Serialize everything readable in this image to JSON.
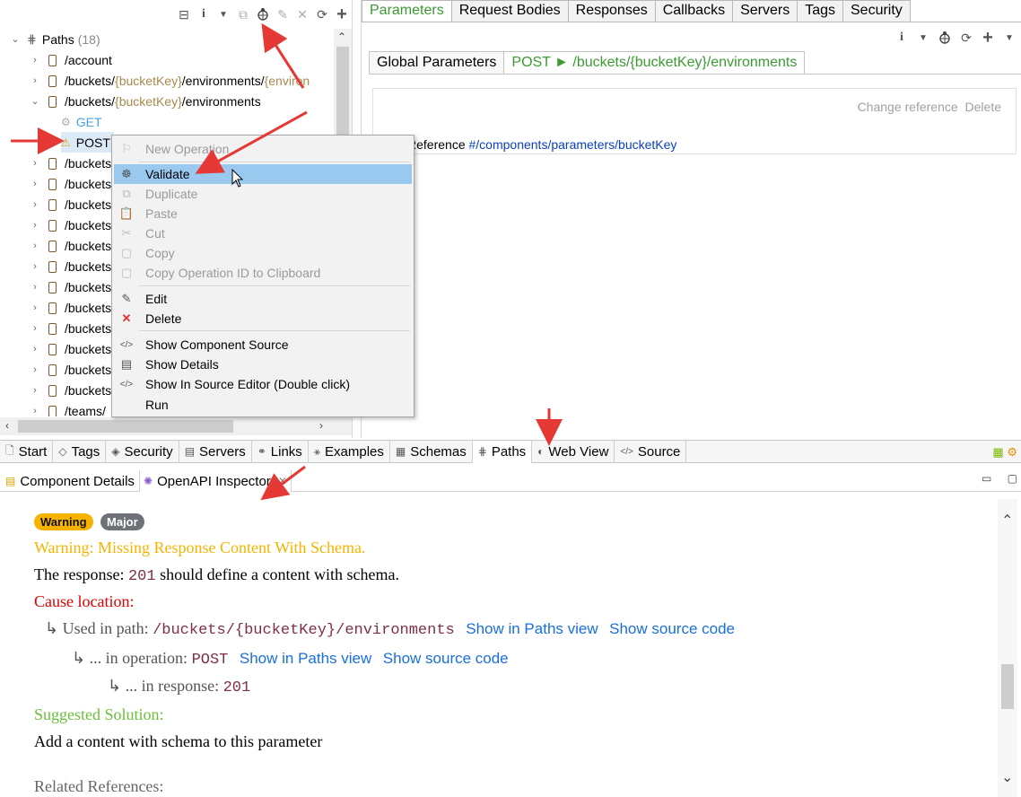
{
  "left_toolbar": {
    "icons": [
      "collapse-icon",
      "info-icon",
      "dropdown-icon",
      "copy-icon",
      "validate-icon",
      "edit-icon",
      "close-icon",
      "refresh-icon",
      "add-icon"
    ]
  },
  "tree": {
    "root_label": "Paths",
    "root_count": "(18)",
    "rows": [
      {
        "prefix": "/account",
        "param": "",
        "suffix": ""
      },
      {
        "prefix": "/buckets/",
        "param": "{bucketKey}",
        "suffix": "/environments/",
        "param2": "{environ"
      },
      {
        "prefix": "/buckets/",
        "param": "{bucketKey}",
        "suffix": "/environments"
      },
      {
        "prefix": "/buckets",
        "param": "",
        "suffix": ""
      },
      {
        "prefix": "/buckets",
        "param": "",
        "suffix": ""
      },
      {
        "prefix": "/buckets",
        "param": "",
        "suffix": ""
      },
      {
        "prefix": "/buckets",
        "param": "",
        "suffix": ""
      },
      {
        "prefix": "/buckets",
        "param": "",
        "suffix": ""
      },
      {
        "prefix": "/buckets",
        "param": "",
        "suffix": ""
      },
      {
        "prefix": "/buckets",
        "param": "",
        "suffix": ""
      },
      {
        "prefix": "/buckets",
        "param": "",
        "suffix": ""
      },
      {
        "prefix": "/buckets",
        "param": "",
        "suffix": ""
      },
      {
        "prefix": "/buckets",
        "param": "",
        "suffix": ""
      },
      {
        "prefix": "/buckets",
        "param": "",
        "suffix": ""
      },
      {
        "prefix": "/buckets",
        "param": "",
        "suffix": ""
      },
      {
        "prefix": "/teams/",
        "param": "",
        "suffix": ""
      }
    ],
    "get_label": "GET",
    "post_label": "POST"
  },
  "top_tabs": [
    "Parameters",
    "Request Bodies",
    "Responses",
    "Callbacks",
    "Servers",
    "Tags",
    "Security"
  ],
  "sub_tabs": {
    "global": "Global Parameters",
    "active": "POST ► /buckets/{bucketKey}/environments"
  },
  "param_box": {
    "change_reference": "Change reference",
    "delete": "Delete",
    "label": "eter Reference",
    "reference": "#/components/parameters/bucketKey"
  },
  "context_menu": {
    "items": [
      {
        "label": "New Operation",
        "icon": "new-icon",
        "disabled": true
      },
      {
        "label": "Validate",
        "icon": "validate-icon",
        "disabled": false,
        "highlight": true
      },
      {
        "label": "Duplicate",
        "icon": "duplicate-icon",
        "disabled": true
      },
      {
        "label": "Paste",
        "icon": "paste-icon",
        "disabled": true
      },
      {
        "label": "Cut",
        "icon": "cut-icon",
        "disabled": true
      },
      {
        "label": "Copy",
        "icon": "copy-icon",
        "disabled": true
      },
      {
        "label": "Copy Operation ID to Clipboard",
        "icon": "clipboard-icon",
        "disabled": true
      },
      {
        "label": "Edit",
        "icon": "edit-icon",
        "disabled": false
      },
      {
        "label": "Delete",
        "icon": "delete-icon",
        "disabled": false
      },
      {
        "label": "Show Component Source",
        "icon": "code-icon",
        "disabled": false
      },
      {
        "label": "Show Details",
        "icon": "details-icon",
        "disabled": false
      },
      {
        "label": "Show In Source Editor (Double click)",
        "icon": "code-icon",
        "disabled": false
      },
      {
        "label": "Run",
        "icon": "",
        "disabled": false
      }
    ]
  },
  "editor_tabs": [
    "Start",
    "Tags",
    "Security",
    "Servers",
    "Links",
    "Examples",
    "Schemas",
    "Paths",
    "Web View",
    "Source"
  ],
  "editor_tabs_active": "Paths",
  "views": {
    "component_details": "Component Details",
    "openapi_inspector": "OpenAPI Inspector"
  },
  "inspector": {
    "badge_warning": "Warning",
    "badge_major": "Major",
    "title": "Warning: Missing Response Content With Schema.",
    "response_prefix": "The response:",
    "response_code": "201",
    "response_suffix": "should define a content with schema.",
    "cause_location": "Cause location:",
    "used_in_path_label": "↳ Used in path:",
    "used_in_path_value": "/buckets/{bucketKey}/environments",
    "show_in_paths_view": "Show in Paths view",
    "show_source_code": "Show source code",
    "in_operation_label": "↳ ... in operation:",
    "in_operation_value": "POST",
    "in_response_label": "↳ ... in response:",
    "in_response_value": "201",
    "suggested_solution": "Suggested Solution:",
    "solution_text": "Add a content with schema to this parameter",
    "related_references": "Related References:"
  },
  "colors": {
    "active_tab_green": "#3b9a31",
    "menu_highlight": "#99c9ef",
    "warning_title": "#f6b400",
    "cause_red": "#e00000",
    "solution_green": "#6cbf3a",
    "link_blue": "#1a6fdc",
    "arrow_red": "#e53935"
  }
}
